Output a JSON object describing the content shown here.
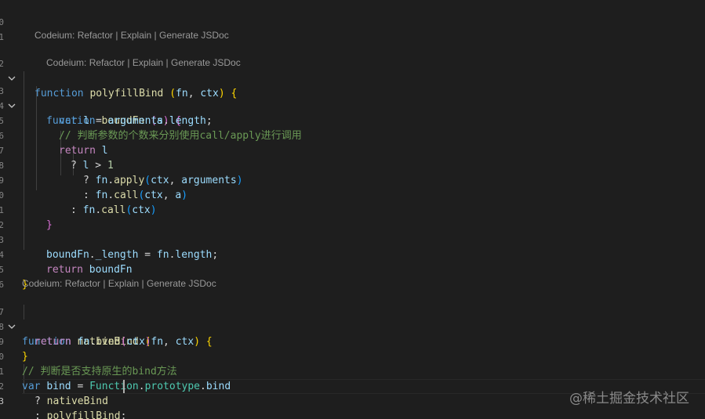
{
  "codelens": {
    "prefix": "Codeium: ",
    "refactor": "Refactor",
    "explain": "Explain",
    "jsdoc": "Generate JSDoc",
    "sep": " | "
  },
  "gutter": {
    "line_numbers": [
      "0",
      "1",
      "2",
      "3",
      "4",
      "5",
      "6",
      "7",
      "8",
      "9",
      "0",
      "1",
      "2",
      "3",
      "4",
      "5",
      "6",
      "7",
      "8",
      "9",
      "0",
      "1",
      "2",
      "3",
      "4"
    ]
  },
  "code": {
    "kw_function": "function",
    "kw_var": "var",
    "kw_return": "return",
    "fn_polyfillBind": "polyfillBind",
    "fn_boundFn": "boundFn",
    "fn_nativeBind": "nativeBind",
    "param_fn": "fn",
    "param_ctx": "ctx",
    "param_a": "a",
    "var_l": "l",
    "arguments": "arguments",
    "length": "length",
    "_length": "_length",
    "apply": "apply",
    "call": "call",
    "bind": "bind",
    "Function": "Function",
    "prototype": "prototype",
    "num_1": "1",
    "comment_args": "// 判断参数的个数来分别使用call/apply进行调用",
    "comment_native": "// 判断是否支持原生的bind方法"
  },
  "watermark": "@稀土掘金技术社区"
}
